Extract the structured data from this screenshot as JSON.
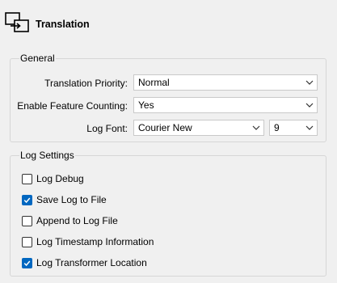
{
  "header": {
    "title": "Translation",
    "icon": "translation-icon"
  },
  "general": {
    "label": "General",
    "translation_priority": {
      "label": "Translation Priority:",
      "value": "Normal"
    },
    "enable_feature_counting": {
      "label": "Enable Feature Counting:",
      "value": "Yes"
    },
    "log_font": {
      "label": "Log Font:",
      "value": "Courier New",
      "size": "9"
    }
  },
  "log_settings": {
    "label": "Log Settings",
    "options": [
      {
        "label": "Log Debug",
        "checked": false
      },
      {
        "label": "Save Log to File",
        "checked": true
      },
      {
        "label": "Append to Log File",
        "checked": false
      },
      {
        "label": "Log Timestamp Information",
        "checked": false
      },
      {
        "label": "Log Transformer Location",
        "checked": true
      }
    ]
  },
  "colors": {
    "accent": "#0067c0",
    "background": "#f0f0f0"
  }
}
